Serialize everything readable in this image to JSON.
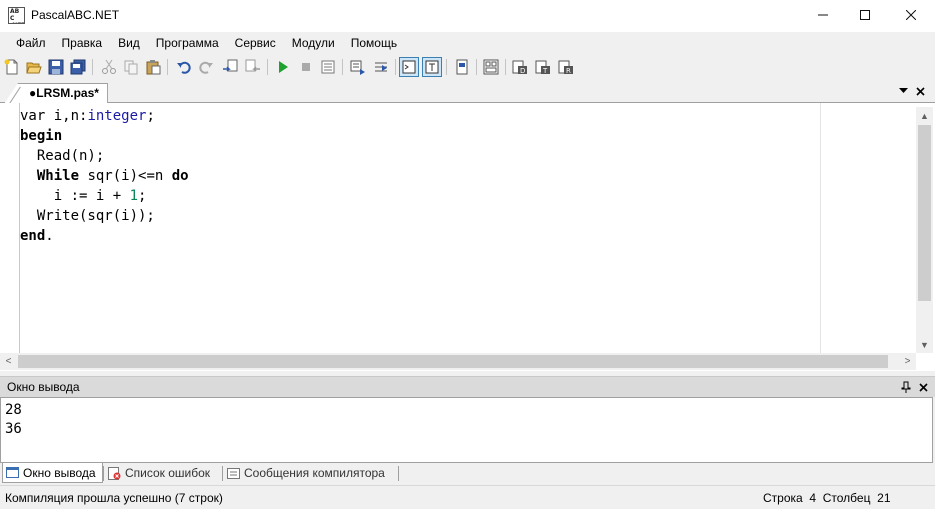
{
  "window": {
    "title": "PascalABC.NET",
    "icon": "pascalabc-app-icon"
  },
  "menu": [
    "Файл",
    "Правка",
    "Вид",
    "Программа",
    "Сервис",
    "Модули",
    "Помощь"
  ],
  "toolbar": {
    "buttons": [
      "new-file-icon",
      "open-file-icon",
      "save-icon",
      "save-all-icon",
      "cut-icon",
      "copy-icon",
      "paste-icon",
      "undo-icon",
      "redo-icon",
      "go-to-icon",
      "go-back-icon",
      "run-icon",
      "stop-icon",
      "compile-icon",
      "debug-step-into-icon",
      "debug-step-over-icon",
      "output-window-icon",
      "text-mode-icon",
      "print-icon",
      "pascal-forms-icon",
      "help-icon",
      "templates-icon",
      "code-format-icon"
    ],
    "accent": "#3c7fb1"
  },
  "editor_tab": {
    "label": "●LRSM.pas*"
  },
  "code": [
    [
      {
        "t": "var",
        "c": "kw-normal"
      },
      {
        "t": " i,n:",
        "c": ""
      },
      {
        "t": "integer",
        "c": "ty"
      },
      {
        "t": ";",
        "c": ""
      }
    ],
    [
      {
        "t": "begin",
        "c": "kw"
      }
    ],
    [
      {
        "t": "  Read(n);",
        "c": ""
      }
    ],
    [
      {
        "t": "  ",
        "c": ""
      },
      {
        "t": "While",
        "c": "kw"
      },
      {
        "t": " sqr(i)<=n ",
        "c": ""
      },
      {
        "t": "do",
        "c": "kw"
      }
    ],
    [
      {
        "t": "    i := i + ",
        "c": ""
      },
      {
        "t": "1",
        "c": "num"
      },
      {
        "t": ";",
        "c": ""
      }
    ],
    [
      {
        "t": "  Write(sqr(i));",
        "c": ""
      }
    ],
    [
      {
        "t": "end",
        "c": "kw"
      },
      {
        "t": ".",
        "c": ""
      }
    ]
  ],
  "output": {
    "title": "Окно вывода",
    "lines": [
      "28",
      "36"
    ]
  },
  "bottom_tabs": [
    {
      "label": "Окно вывода",
      "icon": "output-window-icon",
      "active": true
    },
    {
      "label": "Список ошибок",
      "icon": "error-list-icon",
      "active": false
    },
    {
      "label": "Сообщения компилятора",
      "icon": "compiler-messages-icon",
      "active": false
    }
  ],
  "status": {
    "message": "Компиляция прошла успешно (7 строк)",
    "row_label": "Строка",
    "row": "4",
    "col_label": "Столбец",
    "col": "21"
  }
}
